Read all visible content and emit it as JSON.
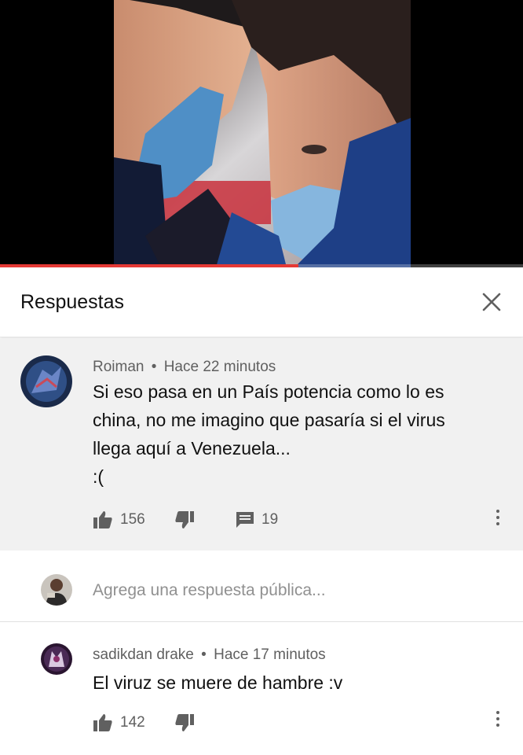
{
  "panel": {
    "title": "Respuestas",
    "close_icon": "close-icon"
  },
  "video": {
    "progress": 0.57
  },
  "parent_comment": {
    "author": "Roiman",
    "time": "Hace 22 minutos",
    "meta_sep": "•",
    "lines": [
      "Si eso pasa en un País potencia como lo es",
      "china, no me imagino que pasaría si el virus",
      "llega aquí a Venezuela...",
      ":("
    ],
    "likes": "156",
    "replies": "19"
  },
  "reply_input": {
    "placeholder": "Agrega una respuesta pública..."
  },
  "reply": {
    "author": "sadikdan drake",
    "time": "Hace 17 minutos",
    "meta_sep": "•",
    "text": "El viruz se muere de hambre :v",
    "likes": "142"
  },
  "colors": {
    "accent": "#e53935",
    "comment_bg": "#f1f1f1",
    "meta": "#606060"
  }
}
